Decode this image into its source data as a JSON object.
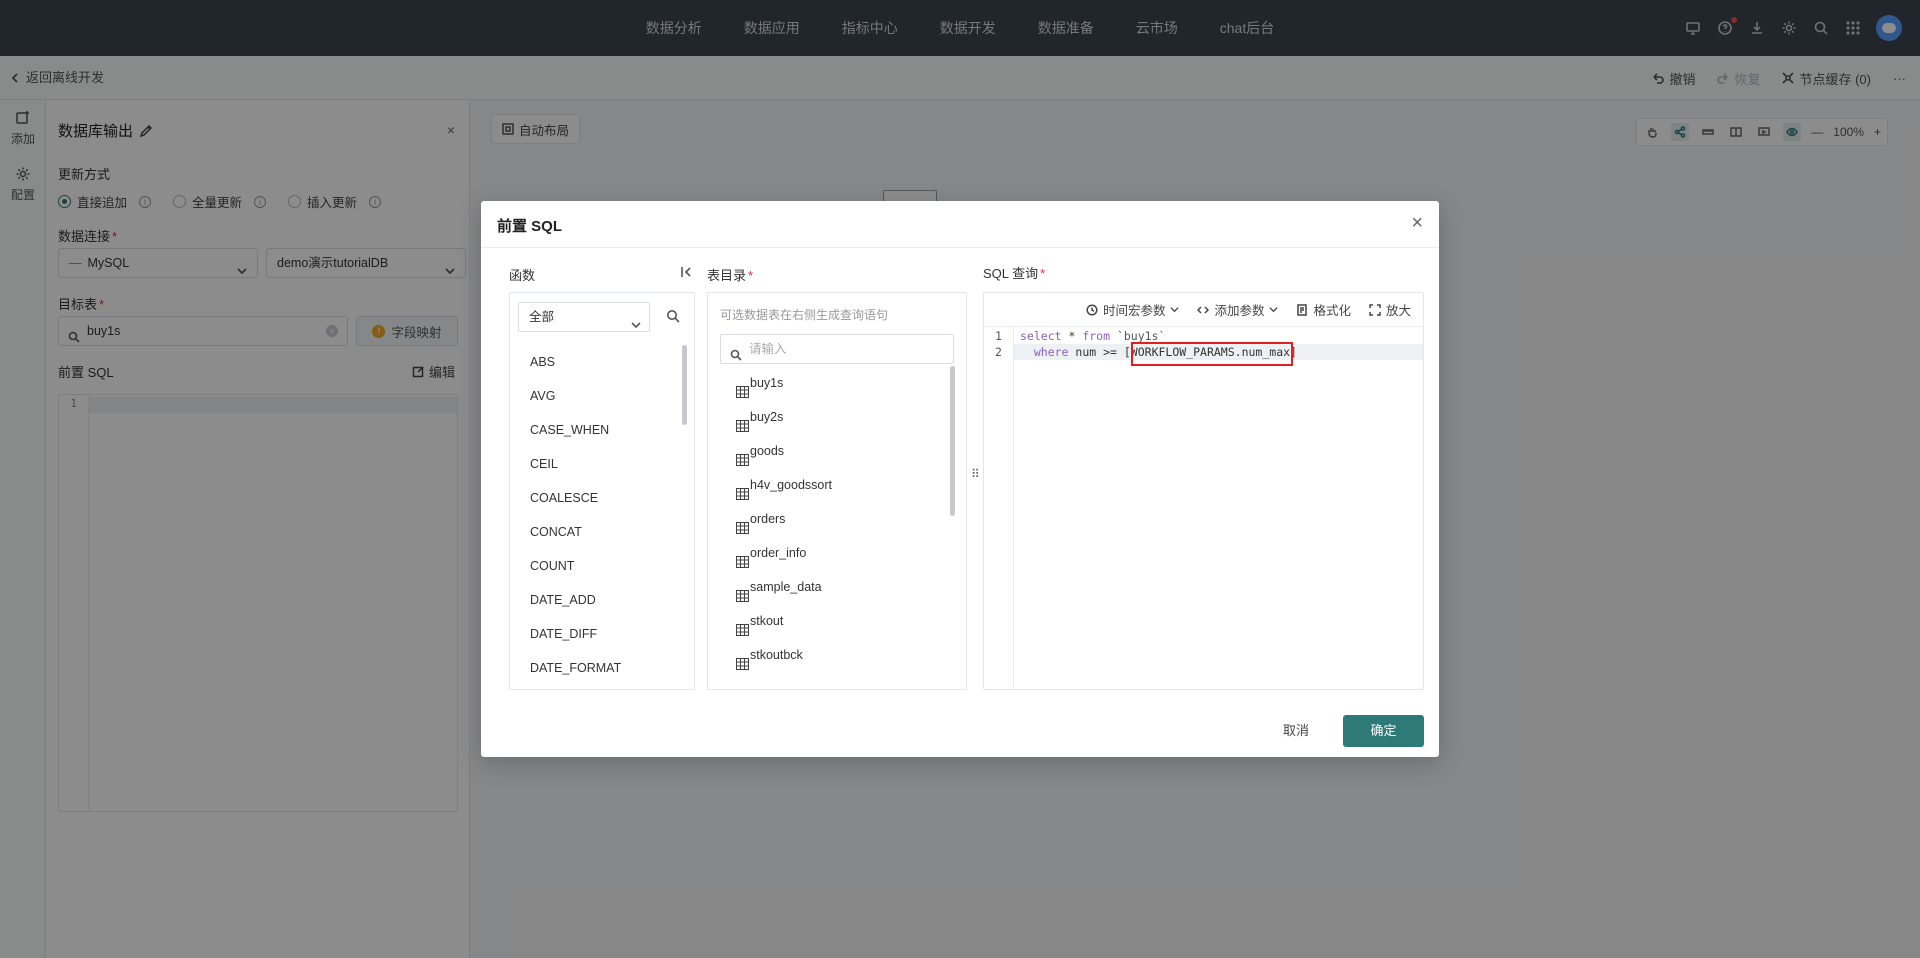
{
  "topnav": {
    "items": [
      "数据分析",
      "数据应用",
      "指标中心",
      "数据开发",
      "数据准备",
      "云市场",
      "chat后台"
    ]
  },
  "subbar": {
    "back_label": "返回离线开发",
    "undo_label": "撤销",
    "redo_label": "恢复",
    "cache_label": "节点缓存 (0)",
    "more_label": "···"
  },
  "rail": {
    "add_label": "添加",
    "config_label": "配置"
  },
  "panel": {
    "title": "数据库输出",
    "close": "×",
    "update_mode_label": "更新方式",
    "modes": [
      "直接追加",
      "全量更新",
      "插入更新"
    ],
    "connection_label": "数据连接",
    "connection_type": "MySQL",
    "connection_type_prefix": "—",
    "database": "demo演示tutorialDB",
    "target_label": "目标表",
    "target_value": "buy1s",
    "field_map_label": "字段映射",
    "pre_sql_label": "前置 SQL",
    "edit_label": "编辑",
    "line_numbers": [
      "1"
    ]
  },
  "canvas": {
    "autolayout_label": "自动布局",
    "zoom": "100%",
    "minus": "—",
    "plus": "+"
  },
  "modal": {
    "title": "前置 SQL",
    "close": "×",
    "functions_label": "函数",
    "fn_filter": "全部",
    "functions": [
      "ABS",
      "AVG",
      "CASE_WHEN",
      "CEIL",
      "COALESCE",
      "CONCAT",
      "COUNT",
      "DATE_ADD",
      "DATE_DIFF",
      "DATE_FORMAT"
    ],
    "tables_label": "表目录",
    "tables_hint": "可选数据表在右侧生成查询语句",
    "tables_placeholder": "请输入",
    "tables": [
      "buy1s",
      "buy2s",
      "goods",
      "h4v_goodssort",
      "orders",
      "order_info",
      "sample_data",
      "stkout",
      "stkoutbck"
    ],
    "sql_label": "SQL 查询",
    "sql_toolbar": {
      "time_macro": "时间宏参数",
      "add_param": "添加参数",
      "format": "格式化",
      "expand": "放大"
    },
    "sql_line_numbers": [
      "1",
      "2"
    ],
    "sql": {
      "l1_kw1": "select",
      "l1_mid": " * ",
      "l1_kw2": "from",
      "l1_tbl": " `buy1s`",
      "l2_indent": "  ",
      "l2_kw": "where",
      "l2_cond": " num >= ",
      "l2_param": "[WORKFLOW_PARAMS.num_max]"
    },
    "cancel_label": "取消",
    "ok_label": "确定"
  },
  "colors": {
    "primary": "#2e7a78",
    "topbar": "#3c4550",
    "highlight_box": "#e02020"
  }
}
